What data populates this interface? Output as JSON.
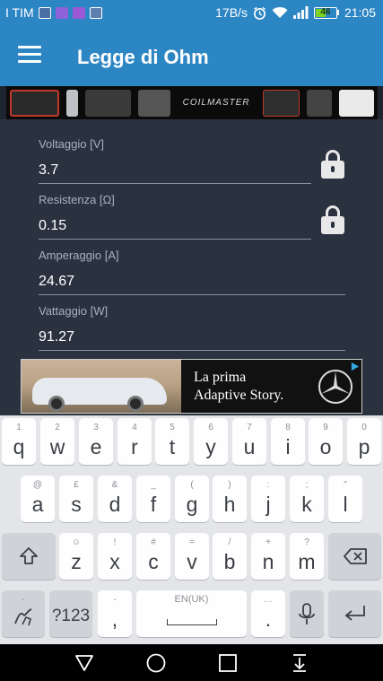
{
  "status_bar": {
    "carrier": "I TIM",
    "speed": "17B/s",
    "battery": "46",
    "time": "21:05"
  },
  "app_bar": {
    "title": "Legge di Ohm"
  },
  "banner": {
    "brand": "COILMASTER"
  },
  "fields": [
    {
      "label": "Voltaggio [V]",
      "value": "3.7",
      "locked": true
    },
    {
      "label": "Resistenza [Ω]",
      "value": "0.15",
      "locked": true
    },
    {
      "label": "Amperaggio [A]",
      "value": "24.67",
      "locked": false
    },
    {
      "label": "Vattaggio [W]",
      "value": "91.27",
      "locked": false
    }
  ],
  "ad": {
    "line1": "La prima",
    "line2": "Adaptive Story."
  },
  "keyboard": {
    "row1": [
      {
        "main": "q",
        "hint": "1"
      },
      {
        "main": "w",
        "hint": "2"
      },
      {
        "main": "e",
        "hint": "3"
      },
      {
        "main": "r",
        "hint": "4"
      },
      {
        "main": "t",
        "hint": "5"
      },
      {
        "main": "y",
        "hint": "6"
      },
      {
        "main": "u",
        "hint": "7"
      },
      {
        "main": "i",
        "hint": "8"
      },
      {
        "main": "o",
        "hint": "9"
      },
      {
        "main": "p",
        "hint": "0"
      }
    ],
    "row2": [
      {
        "main": "a",
        "hint": "@"
      },
      {
        "main": "s",
        "hint": "£"
      },
      {
        "main": "d",
        "hint": "&"
      },
      {
        "main": "f",
        "hint": "_"
      },
      {
        "main": "g",
        "hint": "("
      },
      {
        "main": "h",
        "hint": ")"
      },
      {
        "main": "j",
        "hint": ":"
      },
      {
        "main": "k",
        "hint": ";"
      },
      {
        "main": "l",
        "hint": "\""
      }
    ],
    "row3": [
      {
        "main": "z",
        "hint": "☺"
      },
      {
        "main": "x",
        "hint": "!"
      },
      {
        "main": "c",
        "hint": "#"
      },
      {
        "main": "v",
        "hint": "="
      },
      {
        "main": "b",
        "hint": "/"
      },
      {
        "main": "n",
        "hint": "+"
      },
      {
        "main": "m",
        "hint": "?"
      }
    ],
    "symbols_label": "?123",
    "comma": ",",
    "space_label": "EN(UK)",
    "period": ".",
    "period_hint": "…",
    "comma_hint": "-",
    "sym_hint": "-"
  },
  "colors": {
    "primary": "#2d86c4",
    "background": "#2a3240",
    "battery": "#7ed321"
  },
  "icons": [
    "menu-icon",
    "lock-icon",
    "shift-icon",
    "backspace-icon",
    "handwriting-icon",
    "mic-icon",
    "enter-icon",
    "back-icon",
    "home-icon",
    "recents-icon",
    "hide-keyboard-icon",
    "wifi-icon",
    "signal-icon",
    "alarm-icon"
  ]
}
